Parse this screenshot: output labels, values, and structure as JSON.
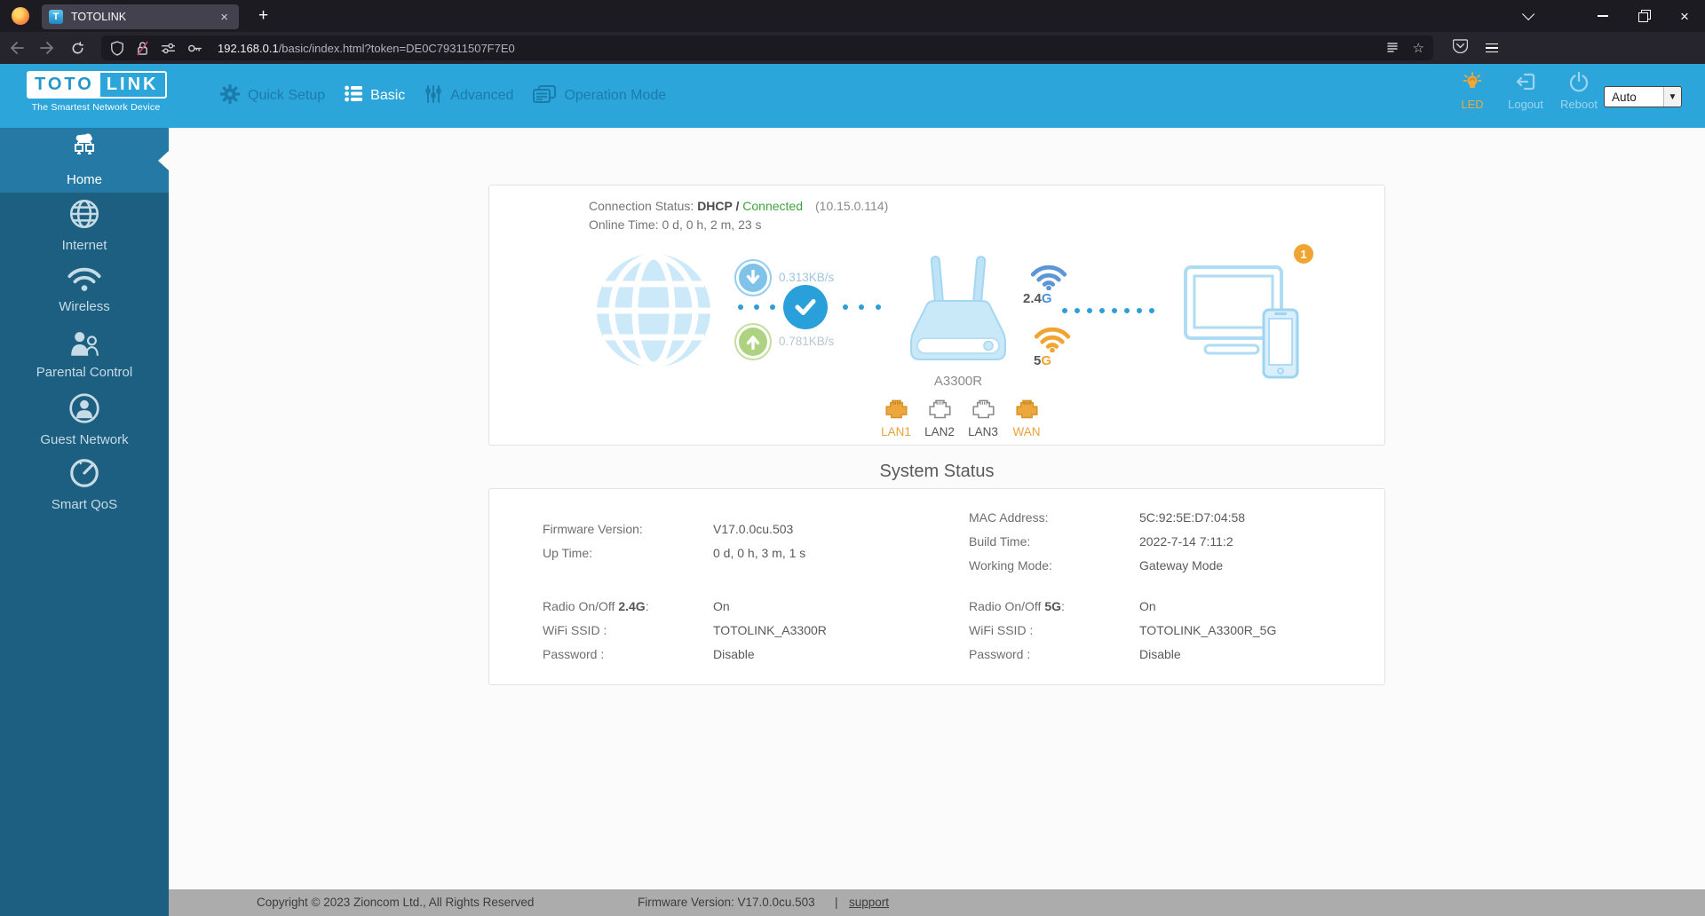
{
  "browser": {
    "tab": {
      "title": "TOTOLINK",
      "favicon_letter": "T"
    },
    "url": {
      "host": "192.168.0.1",
      "path": "/basic/index.html?token=DE0C79311507F7E0"
    }
  },
  "header": {
    "logo": {
      "part1": "TOTO",
      "part2": "LINK",
      "tagline": "The Smartest Network Device"
    },
    "nav": [
      {
        "label": "Quick Setup"
      },
      {
        "label": "Basic"
      },
      {
        "label": "Advanced"
      },
      {
        "label": "Operation Mode"
      }
    ],
    "actions": [
      {
        "label": "LED"
      },
      {
        "label": "Logout"
      },
      {
        "label": "Reboot"
      }
    ],
    "language": {
      "value": "Auto"
    }
  },
  "sidebar": {
    "items": [
      {
        "label": "Home"
      },
      {
        "label": "Internet"
      },
      {
        "label": "Wireless"
      },
      {
        "label": "Parental Control"
      },
      {
        "label": "Guest Network"
      },
      {
        "label": "Smart QoS"
      }
    ]
  },
  "status": {
    "connection_label": "Connection Status: ",
    "connection_type": "DHCP /",
    "connection_state": "Connected",
    "connection_ip": "(10.15.0.114)",
    "online_time": "Online Time: 0 d, 0 h, 2 m, 23 s",
    "download_speed": "0.313KB/s",
    "upload_speed": "0.781KB/s",
    "router_model": "A3300R",
    "band24_num": "2.4",
    "band24_g": "G",
    "band5_num": "5",
    "band5_g": "G",
    "client_count": "1",
    "ports": [
      {
        "label": "LAN1",
        "active": true
      },
      {
        "label": "LAN2",
        "active": false
      },
      {
        "label": "LAN3",
        "active": false
      },
      {
        "label": "WAN",
        "active": true
      }
    ]
  },
  "system_status": {
    "title": "System Status",
    "col_left": [
      {
        "label": "Firmware Version:",
        "value": "V17.0.0cu.503"
      },
      {
        "label": "Up Time:",
        "value": "0 d, 0 h, 3 m, 1 s"
      }
    ],
    "col_right": [
      {
        "label": "MAC Address:",
        "value": "5C:92:5E:D7:04:58"
      },
      {
        "label": "Build Time:",
        "value": "2022-7-14 7:11:2"
      },
      {
        "label": "Working Mode:",
        "value": "Gateway Mode"
      }
    ],
    "radio_left": {
      "prefix": "Radio On/Off ",
      "band": "2.4G",
      "suffix": ":",
      "value": "On"
    },
    "radio_right": {
      "prefix": "Radio On/Off ",
      "band": "5G",
      "suffix": ":",
      "value": "On"
    },
    "wifi_left": [
      {
        "label": "WiFi SSID :",
        "value": "TOTOLINK_A3300R"
      },
      {
        "label": "Password :",
        "value": "Disable"
      }
    ],
    "wifi_right": [
      {
        "label": "WiFi SSID :",
        "value": "TOTOLINK_A3300R_5G"
      },
      {
        "label": "Password :",
        "value": "Disable"
      }
    ]
  },
  "footer": {
    "copyright": "Copyright © 2023 Zioncom Ltd., All Rights Reserved",
    "firmware": "Firmware Version: V17.0.0cu.503",
    "separator": "|",
    "support_link": "support"
  },
  "colors": {
    "accent_blue": "#2CA5DA",
    "sidebar_dark": "#1D5F80",
    "sidebar_active": "#2479A5",
    "port_orange": "#EDA83D",
    "connected_green": "#3FA33F",
    "footer_gray": "#ACACAC"
  }
}
